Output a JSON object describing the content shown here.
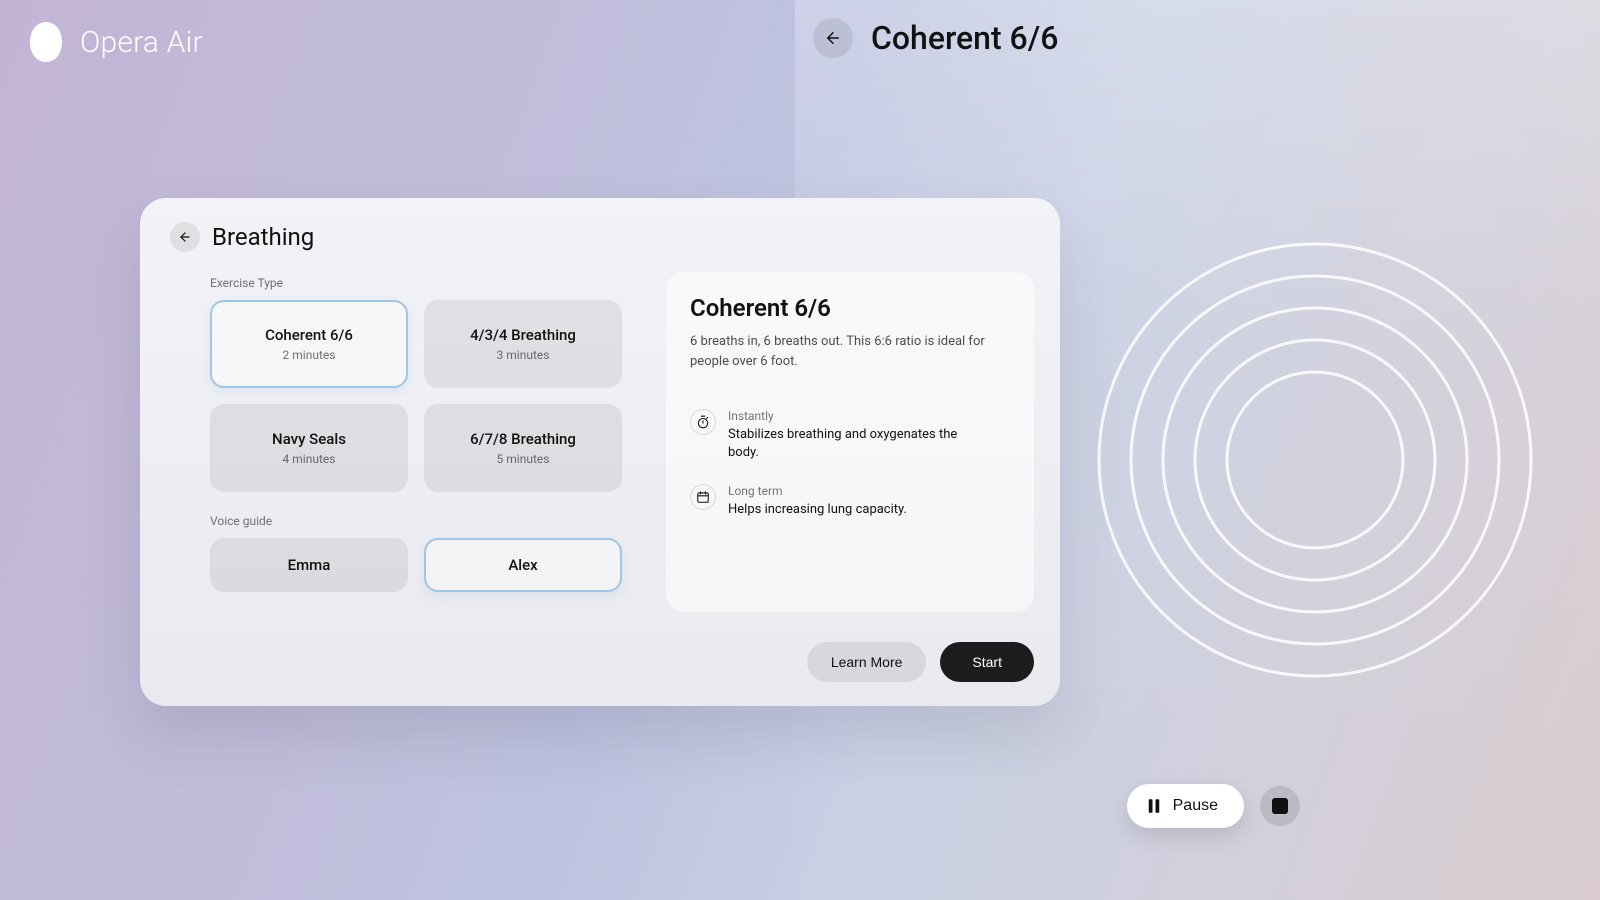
{
  "brand": "Opera Air",
  "right_header": {
    "title": "Coherent 6/6"
  },
  "playback": {
    "pause_label": "Pause"
  },
  "card": {
    "title": "Breathing",
    "exercise_type_label": "Exercise Type",
    "voice_guide_label": "Voice guide",
    "exercises": [
      {
        "title": "Coherent 6/6",
        "duration": "2 minutes",
        "selected": true
      },
      {
        "title": "4/3/4 Breathing",
        "duration": "3 minutes",
        "selected": false
      },
      {
        "title": "Navy Seals",
        "duration": "4 minutes",
        "selected": false
      },
      {
        "title": "6/7/8 Breathing",
        "duration": "5 minutes",
        "selected": false
      }
    ],
    "voices": [
      {
        "name": "Emma",
        "selected": false
      },
      {
        "name": "Alex",
        "selected": true
      }
    ],
    "actions": {
      "learn_more": "Learn More",
      "start": "Start"
    }
  },
  "detail": {
    "title": "Coherent 6/6",
    "description": "6 breaths in, 6 breaths out. This 6:6 ratio is ideal for people over 6 foot.",
    "benefits": [
      {
        "icon": "stopwatch-icon",
        "label": "Instantly",
        "body": "Stabilizes breathing and oxygenates the body."
      },
      {
        "icon": "calendar-icon",
        "label": "Long term",
        "body": "Helps increasing lung capacity."
      }
    ]
  }
}
